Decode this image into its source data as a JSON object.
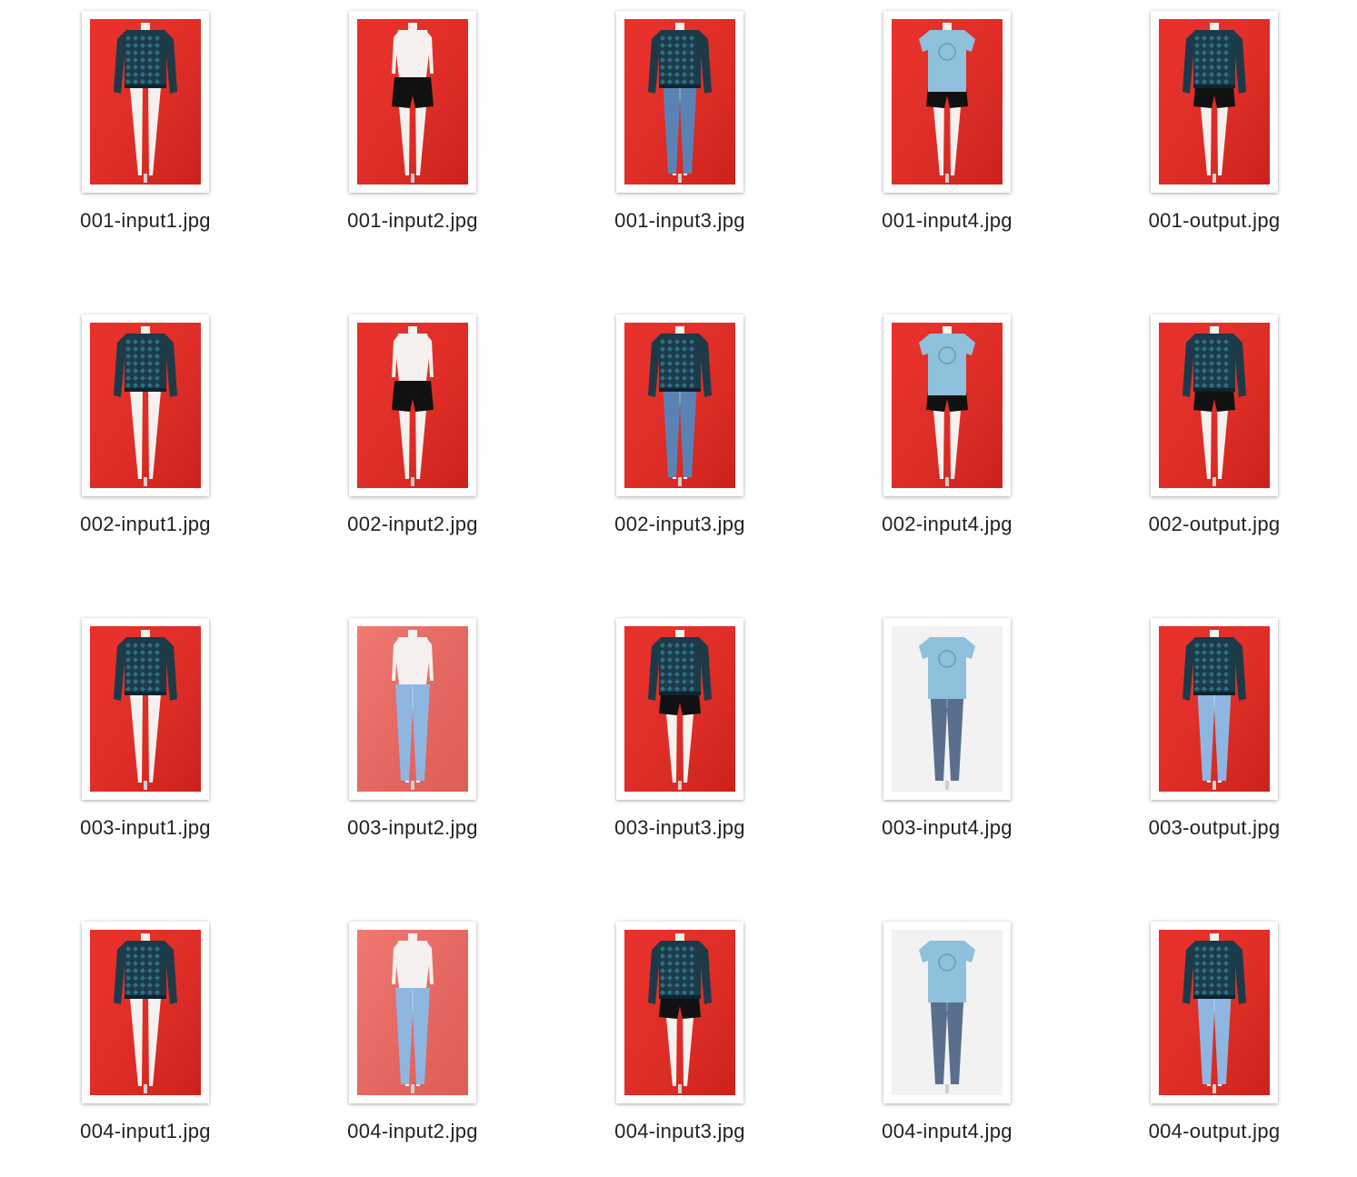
{
  "files": [
    {
      "name": "001-input1.jpg",
      "bg": "red",
      "top": "sweater",
      "bottom": "none"
    },
    {
      "name": "001-input2.jpg",
      "bg": "red",
      "top": "none",
      "bottom": "shorts"
    },
    {
      "name": "001-input3.jpg",
      "bg": "red",
      "top": "sweater",
      "bottom": "jeans"
    },
    {
      "name": "001-input4.jpg",
      "bg": "red",
      "top": "tshirt",
      "bottom": "shorts"
    },
    {
      "name": "001-output.jpg",
      "bg": "red",
      "top": "sweater",
      "bottom": "shorts"
    },
    {
      "name": "002-input1.jpg",
      "bg": "red",
      "top": "sweater",
      "bottom": "none"
    },
    {
      "name": "002-input2.jpg",
      "bg": "red",
      "top": "none",
      "bottom": "shorts"
    },
    {
      "name": "002-input3.jpg",
      "bg": "red",
      "top": "sweater",
      "bottom": "jeans"
    },
    {
      "name": "002-input4.jpg",
      "bg": "red",
      "top": "tshirt",
      "bottom": "shorts"
    },
    {
      "name": "002-output.jpg",
      "bg": "red",
      "top": "sweater",
      "bottom": "shorts"
    },
    {
      "name": "003-input1.jpg",
      "bg": "red",
      "top": "sweater",
      "bottom": "none"
    },
    {
      "name": "003-input2.jpg",
      "bg": "pink",
      "top": "none",
      "bottom": "lightjeans"
    },
    {
      "name": "003-input3.jpg",
      "bg": "red",
      "top": "sweater",
      "bottom": "shorts"
    },
    {
      "name": "003-input4.jpg",
      "bg": "white",
      "top": "tshirt",
      "bottom": "darkjeans"
    },
    {
      "name": "003-output.jpg",
      "bg": "red",
      "top": "sweater",
      "bottom": "lightjeans"
    },
    {
      "name": "004-input1.jpg",
      "bg": "red",
      "top": "sweater",
      "bottom": "none"
    },
    {
      "name": "004-input2.jpg",
      "bg": "pink",
      "top": "none",
      "bottom": "lightjeans"
    },
    {
      "name": "004-input3.jpg",
      "bg": "red",
      "top": "sweater",
      "bottom": "shorts"
    },
    {
      "name": "004-input4.jpg",
      "bg": "white",
      "top": "tshirt",
      "bottom": "darkjeans"
    },
    {
      "name": "004-output.jpg",
      "bg": "red",
      "top": "sweater",
      "bottom": "lightjeans"
    }
  ],
  "colors": {
    "red_bg": "#e8261f",
    "pink_bg": "#f0675f",
    "white_bg": "#f2f2f2",
    "sweater": "#1d3a48",
    "sweater_pattern": "#2f7f95",
    "tshirt": "#8fc0dc",
    "shorts": "#111111",
    "jeans": "#5b82b4",
    "lightjeans": "#8fb6e0",
    "darkjeans": "#5a6f8e",
    "mannequin": "#f4f1ee",
    "label": "#222222"
  }
}
